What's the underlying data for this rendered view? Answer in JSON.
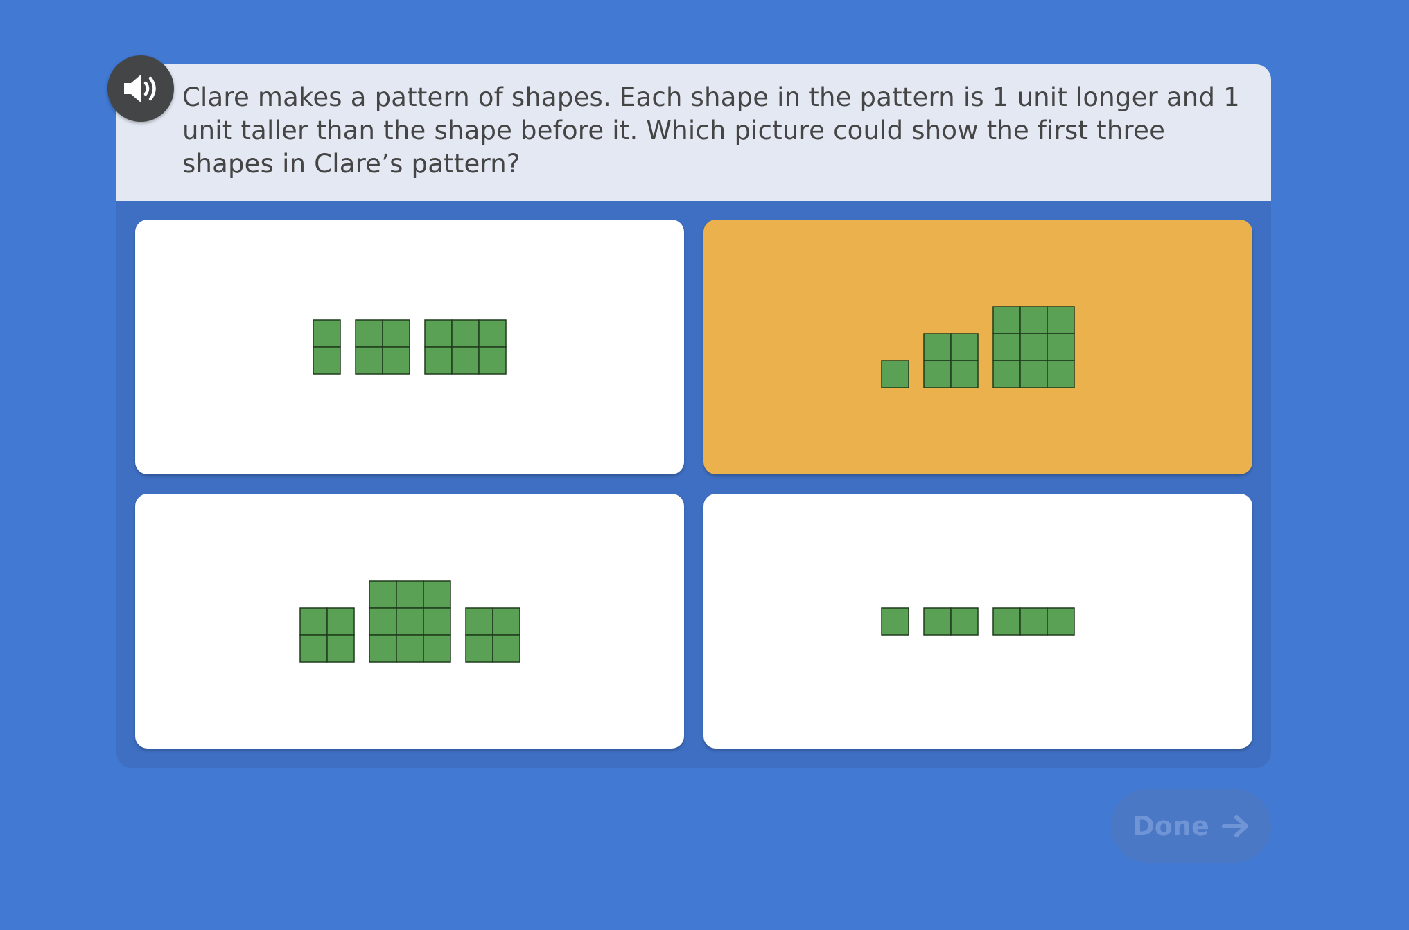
{
  "question": {
    "text": "Clare makes a pattern of shapes. Each shape in the pattern is 1 unit longer and 1 unit taller than the shape before it. Which picture could show the first three shapes in Clare’s pattern?"
  },
  "audio": {
    "icon": "speaker-icon"
  },
  "choices": [
    {
      "id": "A",
      "selected": false,
      "shapes": [
        {
          "cols": 1,
          "rows": 2
        },
        {
          "cols": 2,
          "rows": 2
        },
        {
          "cols": 3,
          "rows": 2
        }
      ]
    },
    {
      "id": "B",
      "selected": true,
      "shapes": [
        {
          "cols": 1,
          "rows": 1
        },
        {
          "cols": 2,
          "rows": 2
        },
        {
          "cols": 3,
          "rows": 3
        }
      ]
    },
    {
      "id": "C",
      "selected": false,
      "shapes": [
        {
          "cols": 2,
          "rows": 2
        },
        {
          "cols": 3,
          "rows": 3
        },
        {
          "cols": 2,
          "rows": 2
        }
      ]
    },
    {
      "id": "D",
      "selected": false,
      "shapes": [
        {
          "cols": 1,
          "rows": 1
        },
        {
          "cols": 2,
          "rows": 1
        },
        {
          "cols": 3,
          "rows": 1
        }
      ]
    }
  ],
  "done": {
    "label": "Done",
    "icon": "arrow-right-icon",
    "enabled": false
  },
  "colors": {
    "background": "#4179d3",
    "selected": "#ebb14c",
    "tile": "#5aa155",
    "tile_border": "#1f3a1c"
  }
}
